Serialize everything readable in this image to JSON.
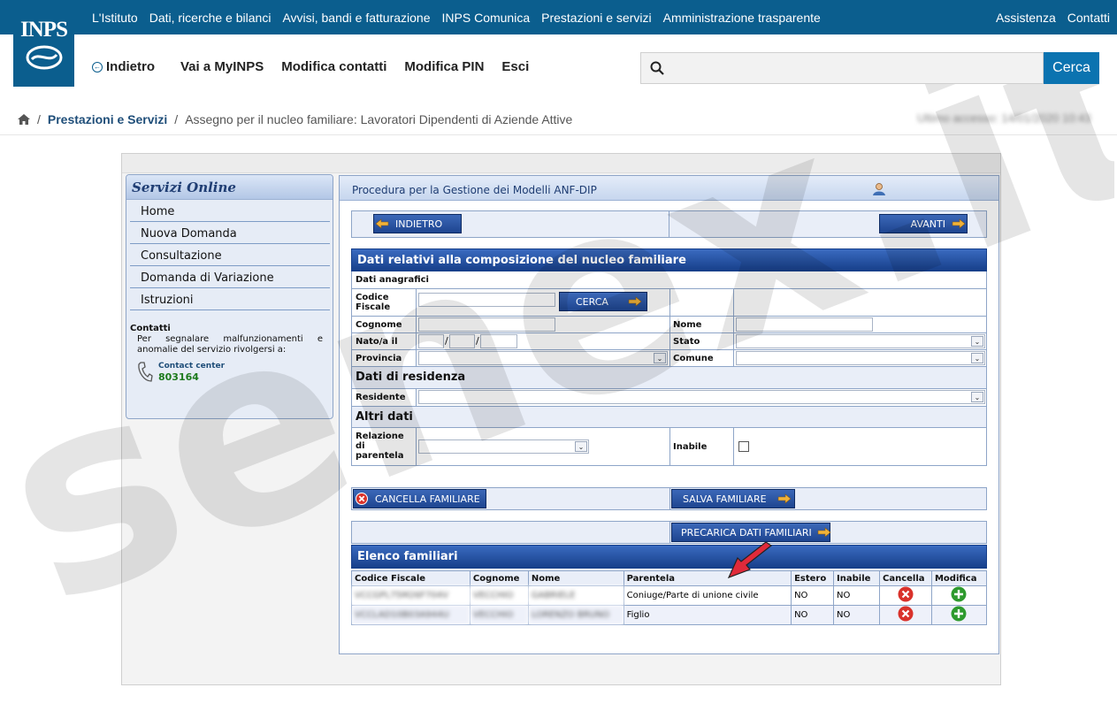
{
  "topbar": {
    "logo": "INPS",
    "nav": [
      "L'Istituto",
      "Dati, ricerche e bilanci",
      "Avvisi, bandi e fatturazione",
      "INPS Comunica",
      "Prestazioni e servizi",
      "Amministrazione trasparente"
    ],
    "right": [
      "Assistenza",
      "Contatti"
    ]
  },
  "subnav": {
    "back": "Indietro",
    "items": [
      "Vai a MyINPS",
      "Modifica contatti",
      "Modifica PIN",
      "Esci"
    ],
    "search_button": "Cerca"
  },
  "breadcrumb": {
    "link": "Prestazioni e Servizi",
    "current": "Assegno per il nucleo familiare: Lavoratori Dipendenti di Aziende Attive",
    "last_access": "Ultimo accesso: 14/01/2020 10:43"
  },
  "sidebar": {
    "title": "Servizi Online",
    "items": [
      "Home",
      "Nuova Domanda",
      "Consultazione",
      "Domanda di Variazione",
      "Istruzioni"
    ],
    "contacts_title": "Contatti",
    "contacts_text": "Per segnalare malfunzionamenti e anomalie del servizio rivolgersi a:",
    "contact_center_label": "Contact center",
    "contact_center_number": "803164"
  },
  "main": {
    "title": "Procedura per la Gestione dei Modelli ANF-DIP",
    "btn_back": "INDIETRO",
    "btn_next": "AVANTI",
    "section_title": "Dati relativi alla composizione del nucleo familiare",
    "anagrafici": "Dati anagrafici",
    "lbl_cf": "Codice Fiscale",
    "btn_cerca": "CERCA",
    "lbl_cognome": "Cognome",
    "lbl_nome": "Nome",
    "lbl_nato": "Nato/a il",
    "lbl_stato": "Stato",
    "lbl_provincia": "Provincia",
    "lbl_comune": "Comune",
    "residenza": "Dati di residenza",
    "lbl_residente": "Residente",
    "altri": "Altri dati",
    "lbl_relazione": "Relazione di parentela",
    "lbl_inabile": "Inabile",
    "btn_cancella": "CANCELLA FAMILIARE",
    "btn_salva": "SALVA FAMILIARE",
    "btn_precarica": "PRECARICA DATI FAMILIARI",
    "elenco": "Elenco familiari",
    "table_headers": [
      "Codice Fiscale",
      "Cognome",
      "Nome",
      "Parentela",
      "Estero",
      "Inabile",
      "Cancella",
      "Modifica"
    ],
    "rows": [
      {
        "cf": "VCCGPL75M26F704V",
        "cognome": "VECCHIO",
        "nome": "GABRIELE",
        "parentela": "Coniuge/Parte di unione civile",
        "estero": "NO",
        "inabile": "NO"
      },
      {
        "cf": "VCCLAD10B03A944U",
        "cognome": "VECCHIO",
        "nome": "LORENZO BRUNO",
        "parentela": "Figlio",
        "estero": "NO",
        "inabile": "NO"
      }
    ]
  },
  "watermark": "senex.it",
  "colors": {
    "brand": "#0b5e8e",
    "section": "#1f4e9e",
    "cancel": "#d9322b",
    "add": "#2e9a2e"
  }
}
